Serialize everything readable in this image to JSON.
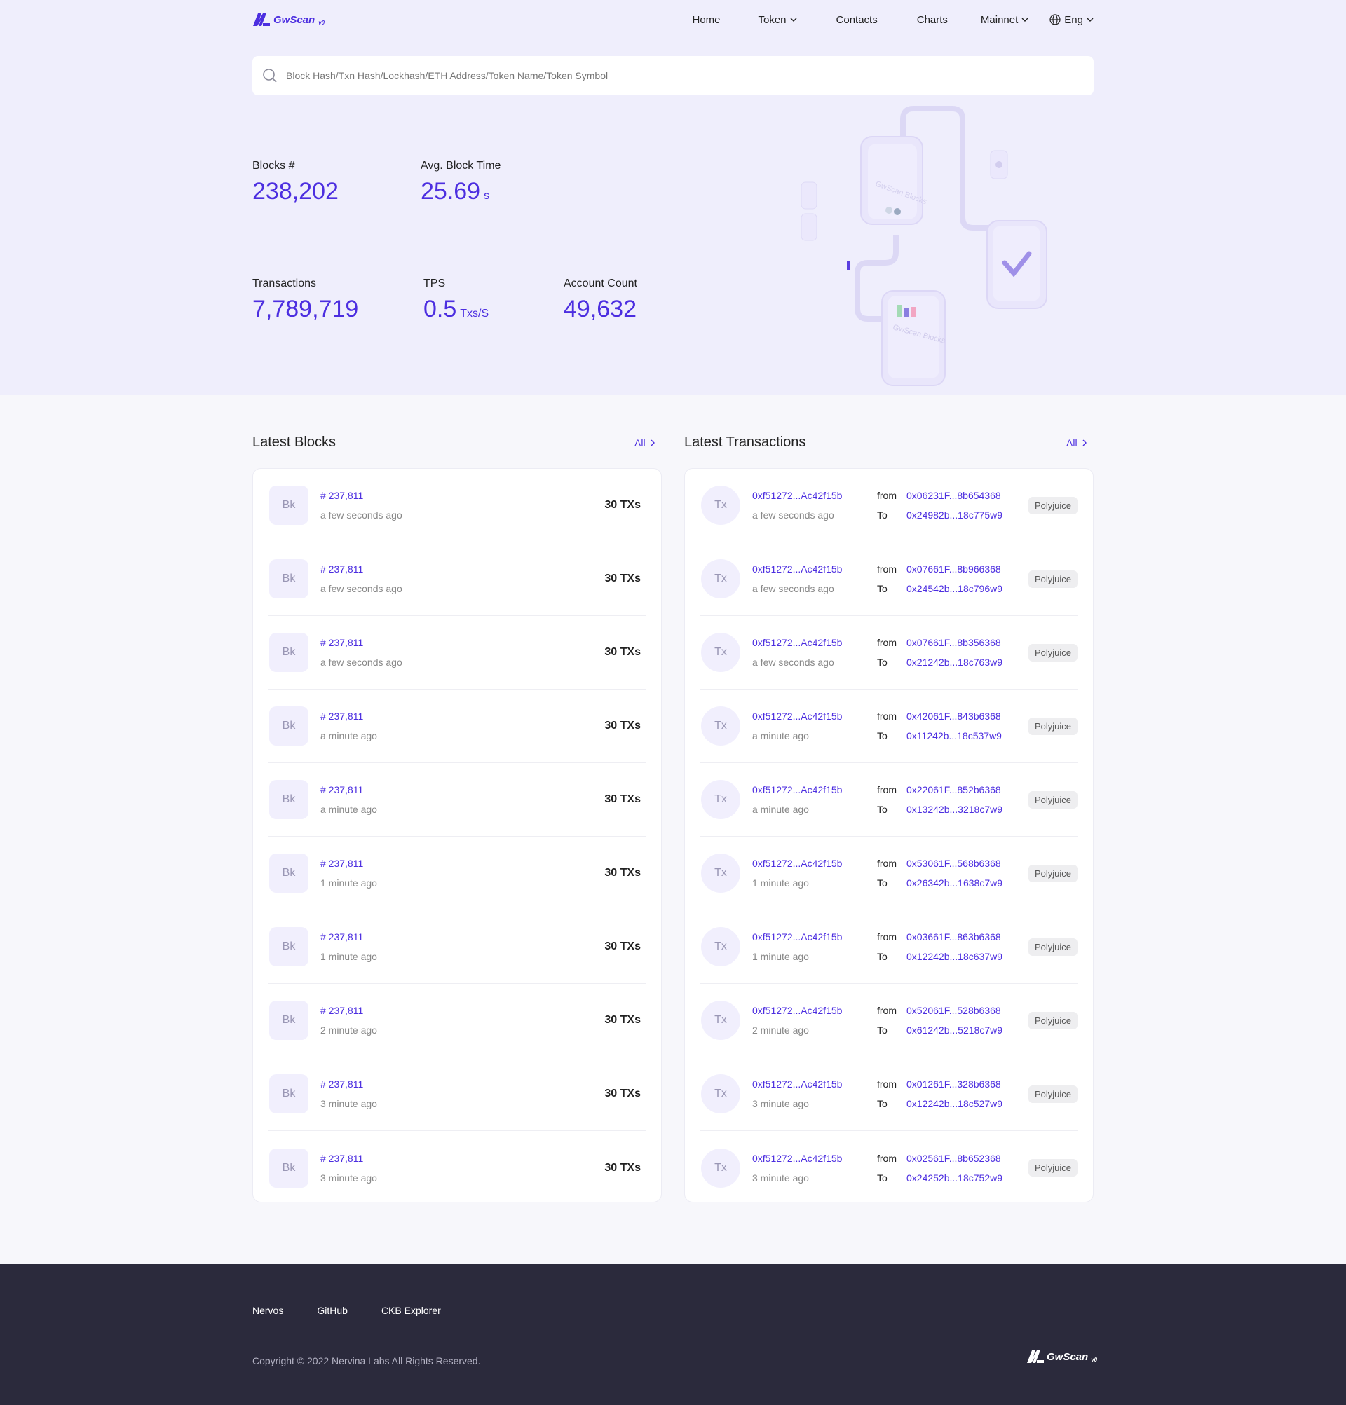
{
  "brand": {
    "name": "GwScan",
    "version": "v0",
    "accent": "#4c2ee0"
  },
  "nav": {
    "items": [
      "Home",
      "Token",
      "Contacts",
      "Charts",
      "Mainnet",
      "Eng"
    ]
  },
  "search": {
    "placeholder": "Block Hash/Txn Hash/Lockhash/ETH Address/Token Name/Token Symbol"
  },
  "stats": {
    "blocks": {
      "label": "Blocks #",
      "value": "238,202"
    },
    "avg_block_time": {
      "label": "Avg. Block Time",
      "value": "25.69",
      "unit": "s"
    },
    "transactions": {
      "label": "Transactions",
      "value": "7,789,719"
    },
    "tps": {
      "label": "TPS",
      "value": "0.5",
      "unit": "Txs/S"
    },
    "account_count": {
      "label": "Account Count",
      "value": "49,632"
    }
  },
  "latest_blocks": {
    "title": "Latest Blocks",
    "all_label": "All",
    "badge": "Bk",
    "rows": [
      {
        "number": "# 237,811",
        "age": "a few seconds ago",
        "txs": "30 TXs"
      },
      {
        "number": "# 237,811",
        "age": "a few seconds ago",
        "txs": "30 TXs"
      },
      {
        "number": "# 237,811",
        "age": "a few seconds ago",
        "txs": "30 TXs"
      },
      {
        "number": "# 237,811",
        "age": "a minute ago",
        "txs": "30 TXs"
      },
      {
        "number": "# 237,811",
        "age": "a minute ago",
        "txs": "30 TXs"
      },
      {
        "number": "# 237,811",
        "age": "1 minute ago",
        "txs": "30 TXs"
      },
      {
        "number": "# 237,811",
        "age": "1 minute ago",
        "txs": "30 TXs"
      },
      {
        "number": "# 237,811",
        "age": "2 minute ago",
        "txs": "30 TXs"
      },
      {
        "number": "# 237,811",
        "age": "3 minute ago",
        "txs": "30 TXs"
      },
      {
        "number": "# 237,811",
        "age": "3 minute ago",
        "txs": "30 TXs"
      }
    ]
  },
  "latest_transactions": {
    "title": "Latest Transactions",
    "all_label": "All",
    "badge": "Tx",
    "from_label": "from",
    "to_label": "To",
    "rows": [
      {
        "hash": "0xf51272...Ac42f15b",
        "age": "a few seconds ago",
        "from": "0x06231F...8b654368",
        "to": "0x24982b...18c775w9",
        "type": "Polyjuice"
      },
      {
        "hash": "0xf51272...Ac42f15b",
        "age": "a few seconds ago",
        "from": "0x07661F...8b966368",
        "to": "0x24542b...18c796w9",
        "type": "Polyjuice"
      },
      {
        "hash": "0xf51272...Ac42f15b",
        "age": "a few seconds ago",
        "from": "0x07661F...8b356368",
        "to": "0x21242b...18c763w9",
        "type": "Polyjuice"
      },
      {
        "hash": "0xf51272...Ac42f15b",
        "age": "a minute ago",
        "from": "0x42061F...843b6368",
        "to": "0x11242b...18c537w9",
        "type": "Polyjuice"
      },
      {
        "hash": "0xf51272...Ac42f15b",
        "age": "a minute ago",
        "from": "0x22061F...852b6368",
        "to": "0x13242b...3218c7w9",
        "type": "Polyjuice"
      },
      {
        "hash": "0xf51272...Ac42f15b",
        "age": "1 minute ago",
        "from": "0x53061F...568b6368",
        "to": "0x26342b...1638c7w9",
        "type": "Polyjuice"
      },
      {
        "hash": "0xf51272...Ac42f15b",
        "age": "1 minute ago",
        "from": "0x03661F...863b6368",
        "to": "0x12242b...18c637w9",
        "type": "Polyjuice"
      },
      {
        "hash": "0xf51272...Ac42f15b",
        "age": "2 minute ago",
        "from": "0x52061F...528b6368",
        "to": "0x61242b...5218c7w9",
        "type": "Polyjuice"
      },
      {
        "hash": "0xf51272...Ac42f15b",
        "age": "3 minute ago",
        "from": "0x01261F...328b6368",
        "to": "0x12242b...18c527w9",
        "type": "Polyjuice"
      },
      {
        "hash": "0xf51272...Ac42f15b",
        "age": "3 minute ago",
        "from": "0x02561F...8b652368",
        "to": "0x24252b...18c752w9",
        "type": "Polyjuice"
      }
    ]
  },
  "footer": {
    "links": [
      "Nervos",
      "GitHub",
      "CKB Explorer"
    ],
    "copyright": "Copyright © 2022 Nervina Labs All Rights Reserved."
  }
}
